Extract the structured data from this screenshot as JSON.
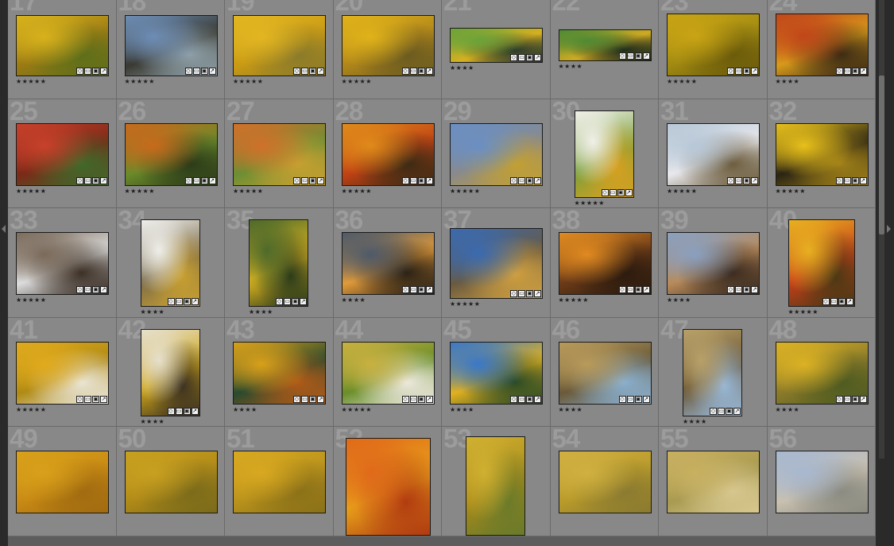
{
  "grid": {
    "cells": [
      {
        "index": "17",
        "stars": "★★★★★",
        "thumb": "autumn-aspens-forest",
        "colors": [
          "#d8b21c",
          "#9a7a14",
          "#5d6e1a"
        ]
      },
      {
        "index": "18",
        "stars": "★★★★★",
        "thumb": "bridge-over-river",
        "colors": [
          "#6d8db5",
          "#3a3a32",
          "#8fa0a8"
        ]
      },
      {
        "index": "19",
        "stars": "★★★★★",
        "thumb": "yellow-grass-meadow",
        "colors": [
          "#e2b622",
          "#c99a14",
          "#8a7a2a"
        ]
      },
      {
        "index": "20",
        "stars": "★★★★★",
        "thumb": "golden-forest-trunks",
        "colors": [
          "#e0b21a",
          "#b0861a",
          "#6a5a20"
        ]
      },
      {
        "index": "21",
        "stars": "★★★★",
        "thumb": "reflection-lake",
        "colors": [
          "#6aa33a",
          "#d6b020",
          "#2a3a2a"
        ]
      },
      {
        "index": "22",
        "stars": "★★★★",
        "thumb": "reflection-lake-2",
        "colors": [
          "#4f8a34",
          "#cfaa22",
          "#1e2a1c"
        ]
      },
      {
        "index": "23",
        "stars": "★★★★★",
        "thumb": "yellow-leaves",
        "colors": [
          "#c9a414",
          "#a08a12",
          "#6a5a0a"
        ]
      },
      {
        "index": "24",
        "stars": "★★★★",
        "thumb": "fall-foliage-tangle",
        "colors": [
          "#c2461a",
          "#d79a1a",
          "#3a2a14"
        ]
      },
      {
        "index": "25",
        "stars": "★★★★★",
        "thumb": "red-maples",
        "colors": [
          "#c8402a",
          "#7a2a18",
          "#3f6a2a"
        ]
      },
      {
        "index": "26",
        "stars": "★★★★★",
        "thumb": "orange-forest",
        "colors": [
          "#c86a1c",
          "#6a8a2a",
          "#2a3a18"
        ]
      },
      {
        "index": "27",
        "stars": "★★★★★",
        "thumb": "mixed-foliage",
        "colors": [
          "#d0702a",
          "#6c8e34",
          "#c8a030"
        ]
      },
      {
        "index": "28",
        "stars": "★★★★★",
        "thumb": "orange-leaves-closeup",
        "colors": [
          "#e08a1a",
          "#c04214",
          "#3a2a14"
        ]
      },
      {
        "index": "29",
        "stars": "★★★★★",
        "thumb": "half-dome-valley",
        "colors": [
          "#6a8fc4",
          "#8a8a8a",
          "#c4a030"
        ]
      },
      {
        "index": "30",
        "stars": "★★★★★",
        "thumb": "snow-on-leaves",
        "colors": [
          "#f0f0ea",
          "#7aa03a",
          "#d8a020"
        ]
      },
      {
        "index": "31",
        "stars": "★★★★★",
        "thumb": "snowy-valley-tree",
        "colors": [
          "#b8c8d8",
          "#e8e8ec",
          "#6a5a3a"
        ]
      },
      {
        "index": "32",
        "stars": "★★★★★",
        "thumb": "yellow-leaf-on-ground",
        "colors": [
          "#e8c01a",
          "#2a2414",
          "#a08018"
        ]
      },
      {
        "index": "33",
        "stars": "★★★★★",
        "thumb": "snowy-forest",
        "colors": [
          "#7a6a5a",
          "#dcdcdc",
          "#3a2e24"
        ]
      },
      {
        "index": "34",
        "stars": "★★★★",
        "thumb": "white-birch-trunks",
        "colors": [
          "#eeeeea",
          "#7a6a4a",
          "#c8a030"
        ]
      },
      {
        "index": "35",
        "stars": "★★★★",
        "thumb": "single-leaf-green",
        "colors": [
          "#4e6a2a",
          "#e2b820",
          "#2a3a1a"
        ]
      },
      {
        "index": "36",
        "stars": "★★★★",
        "thumb": "canyon-rainbow",
        "colors": [
          "#4e5a6a",
          "#e09a3a",
          "#2a2014"
        ]
      },
      {
        "index": "37",
        "stars": "★★★★★",
        "thumb": "rainbow-deadwood",
        "colors": [
          "#3a6ab0",
          "#6a5a40",
          "#d0a040"
        ]
      },
      {
        "index": "38",
        "stars": "★★★★★",
        "thumb": "canyon-sunset",
        "colors": [
          "#e08a20",
          "#6a3a18",
          "#2a1a0e"
        ]
      },
      {
        "index": "39",
        "stars": "★★★★",
        "thumb": "photographer-overlook",
        "colors": [
          "#8aa0c0",
          "#b88a5a",
          "#3a2a1e"
        ]
      },
      {
        "index": "40",
        "stars": "★★★★★",
        "thumb": "yellow-leaves-red-leaf",
        "colors": [
          "#e8b020",
          "#c8401a",
          "#4a3814"
        ]
      },
      {
        "index": "41",
        "stars": "★★★★★",
        "thumb": "golden-aspen-grove",
        "colors": [
          "#e0aa1c",
          "#b08a14",
          "#eae6d8"
        ]
      },
      {
        "index": "42",
        "stars": "★★★★",
        "thumb": "aspen-trunks-close",
        "colors": [
          "#e6e0cc",
          "#cfa61a",
          "#3a3020"
        ]
      },
      {
        "index": "43",
        "stars": "★★★★",
        "thumb": "aspens-hillside",
        "colors": [
          "#d8a01a",
          "#2a4a2e",
          "#b05a18"
        ]
      },
      {
        "index": "44",
        "stars": "★★★★★",
        "thumb": "green-aspens",
        "colors": [
          "#c8b040",
          "#6a8e2a",
          "#eeeae0"
        ]
      },
      {
        "index": "45",
        "stars": "★★★★",
        "thumb": "aspen-hill-blue-sky",
        "colors": [
          "#3a78c8",
          "#e0b020",
          "#2a4a24"
        ]
      },
      {
        "index": "46",
        "stars": "★★★★",
        "thumb": "meadow-tracks",
        "colors": [
          "#b89a5a",
          "#6a5a3a",
          "#8ab0d0"
        ]
      },
      {
        "index": "47",
        "stars": "★★★★",
        "thumb": "meadow-tracks-vertical",
        "colors": [
          "#b8a068",
          "#6a5634",
          "#98b8d8"
        ]
      },
      {
        "index": "48",
        "stars": "★★★★",
        "thumb": "aspens-autumn-path",
        "colors": [
          "#dcb224",
          "#8a7a2a",
          "#4e5a20"
        ]
      },
      {
        "index": "49",
        "stars": "",
        "thumb": "partial-49",
        "colors": [
          "#d8a01a",
          "#c88a14",
          "#a06a10"
        ]
      },
      {
        "index": "50",
        "stars": "",
        "thumb": "partial-50",
        "colors": [
          "#c8a020",
          "#b08a18",
          "#7a6a1a"
        ]
      },
      {
        "index": "51",
        "stars": "",
        "thumb": "partial-51",
        "colors": [
          "#d8a820",
          "#b8921c",
          "#8a7018"
        ]
      },
      {
        "index": "52",
        "stars": "",
        "thumb": "partial-52",
        "colors": [
          "#e06a1a",
          "#e8a21a",
          "#b03a10"
        ]
      },
      {
        "index": "53",
        "stars": "",
        "thumb": "partial-53",
        "colors": [
          "#d0b030",
          "#a88a1a",
          "#6a7a2a"
        ]
      },
      {
        "index": "54",
        "stars": "",
        "thumb": "partial-54",
        "colors": [
          "#d0b040",
          "#b89a2a",
          "#8a7a30"
        ]
      },
      {
        "index": "55",
        "stars": "",
        "thumb": "partial-55",
        "colors": [
          "#c8b060",
          "#a89a50",
          "#d8c890"
        ]
      },
      {
        "index": "56",
        "stars": "",
        "thumb": "partial-56",
        "colors": [
          "#a8b8d0",
          "#c8c0b0",
          "#8a8a80"
        ]
      }
    ]
  }
}
